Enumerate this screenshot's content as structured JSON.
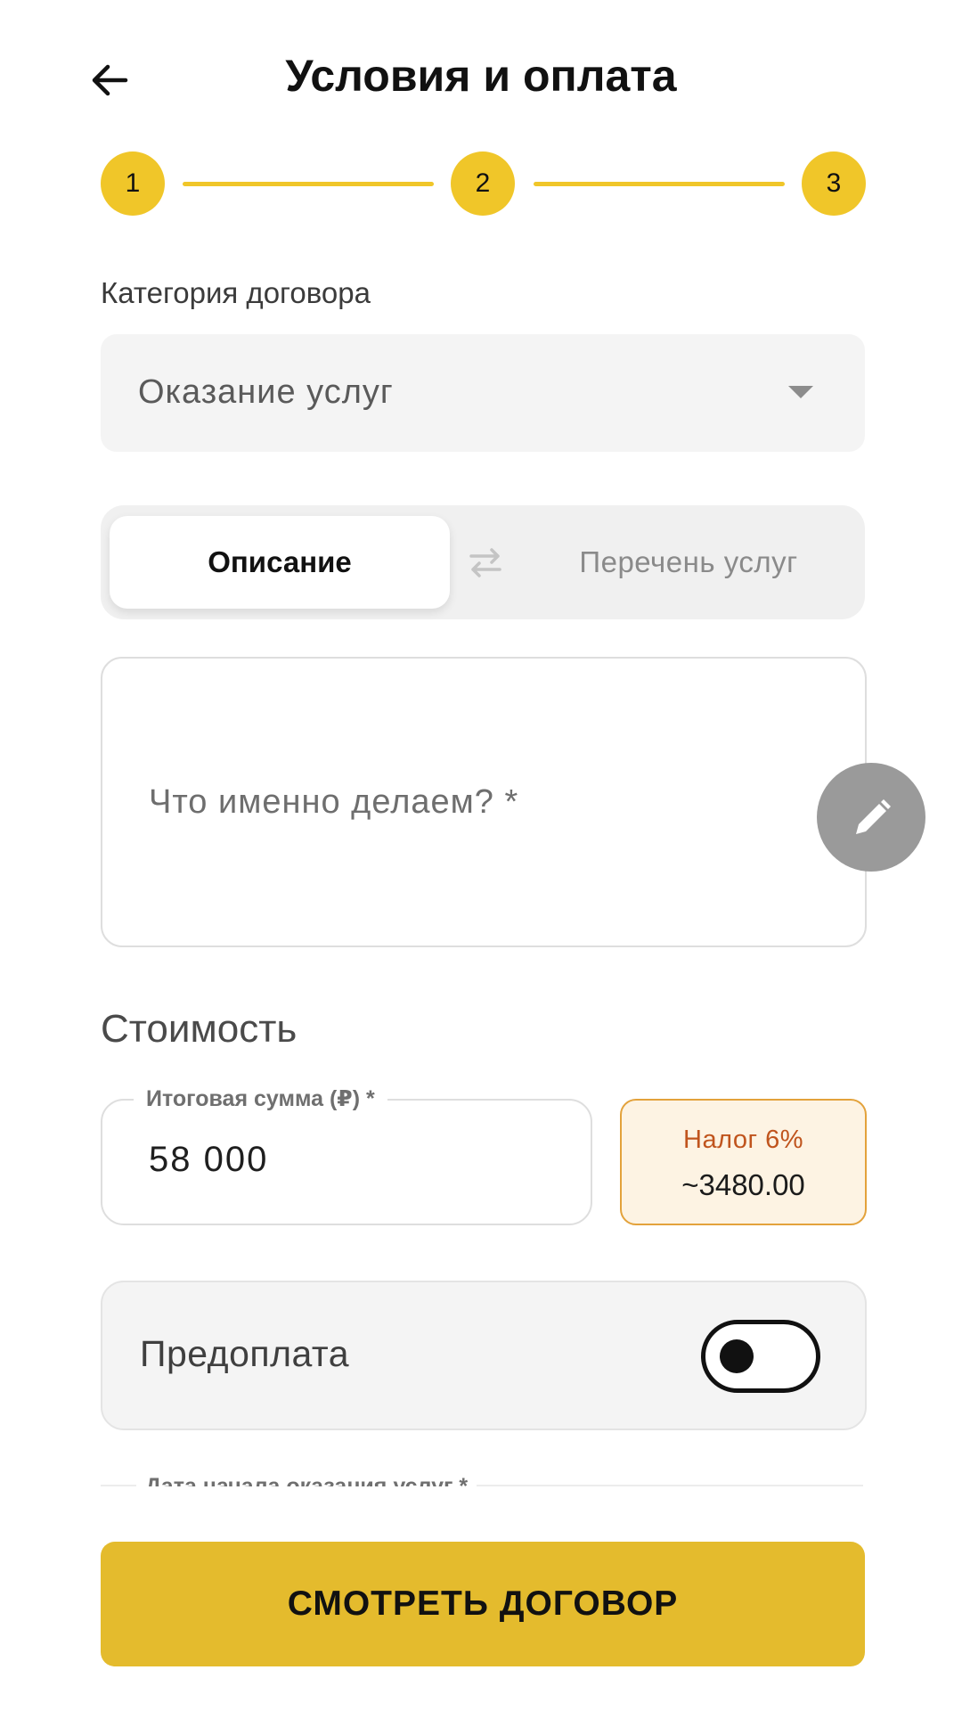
{
  "header": {
    "title": "Условия и оплата",
    "back_icon": "arrow-left-icon"
  },
  "stepper": {
    "steps": [
      "1",
      "2",
      "3"
    ],
    "active_color": "#f0c629"
  },
  "category": {
    "label": "Категория договора",
    "value": "Оказание услуг"
  },
  "segmented": {
    "active_label": "Описание",
    "inactive_label": "Перечень услуг"
  },
  "description": {
    "placeholder": "Что именно делаем? *"
  },
  "cost": {
    "section_title": "Стоимость",
    "amount_label": "Итоговая сумма (₽) *",
    "amount_value": "58 000",
    "tax_label": "Налог 6%",
    "tax_value": "~3480.00"
  },
  "prepayment": {
    "label": "Предоплата",
    "enabled": false
  },
  "next_field": {
    "label": "Дата начала оказания услуг *"
  },
  "cta": {
    "label": "СМОТРЕТЬ ДОГОВОР",
    "color": "#e4bb2d"
  }
}
